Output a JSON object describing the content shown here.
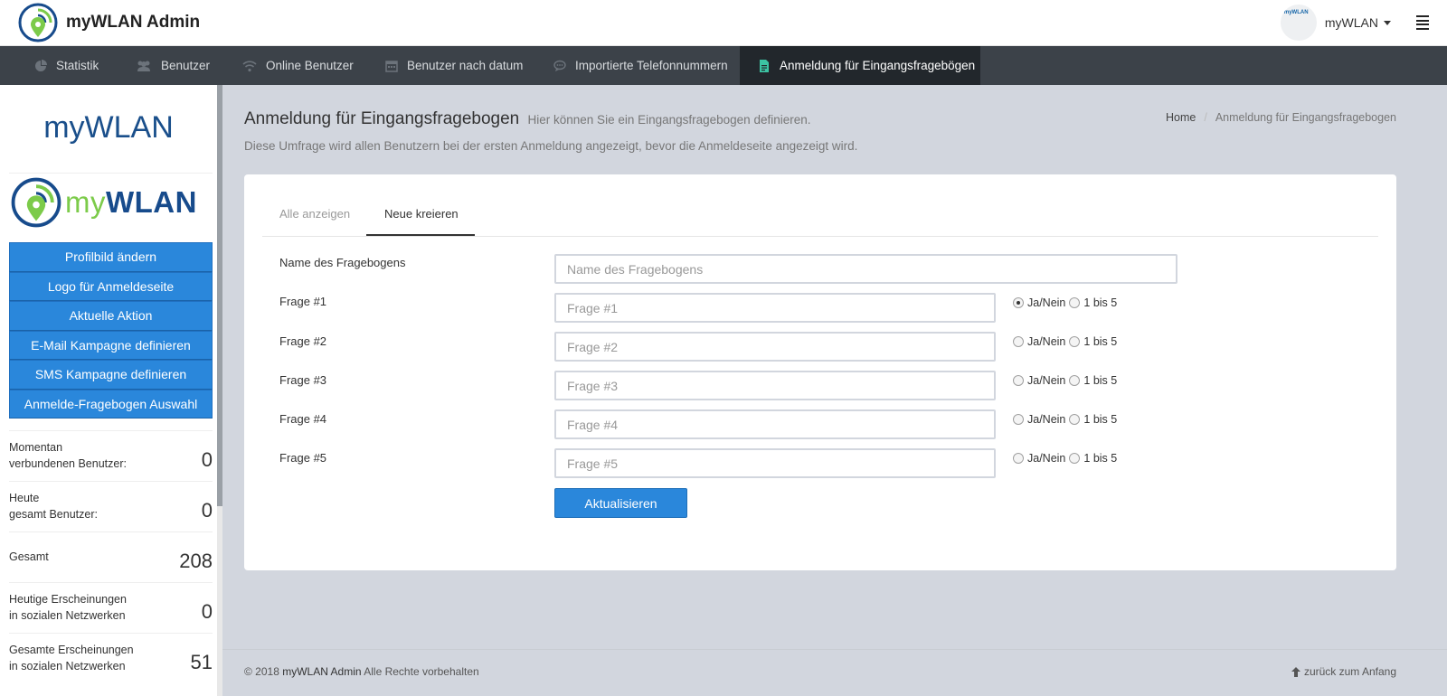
{
  "header": {
    "title": "myWLAN Admin",
    "avatar_text": "myWLAN",
    "user_name": "myWLAN"
  },
  "nav": {
    "items": [
      {
        "label": "Statistik",
        "icon": "pie-chart-icon"
      },
      {
        "label": "Benutzer",
        "icon": "users-icon"
      },
      {
        "label": "Online Benutzer",
        "icon": "wifi-icon"
      },
      {
        "label": "Benutzer nach datum",
        "icon": "calendar-icon"
      },
      {
        "label": "Importierte Telefonnummern",
        "icon": "chat-icon"
      },
      {
        "label": "Anmeldung für Eingangsfragebögen",
        "icon": "document-icon",
        "active": true
      }
    ]
  },
  "sidebar": {
    "title": "myWLAN",
    "logo_my": "my",
    "logo_wlan": "WLAN",
    "buttons": [
      "Profilbild ändern",
      "Logo für Anmeldeseite",
      "Aktuelle Aktion",
      "E-Mail Kampagne definieren",
      "SMS Kampagne definieren",
      "Anmelde-Fragebogen Auswahl"
    ],
    "stats": [
      {
        "label1": "Momentan",
        "label2": "verbundenen Benutzer:",
        "value": "0"
      },
      {
        "label1": "Heute",
        "label2": "gesamt Benutzer:",
        "value": "0"
      },
      {
        "label1": "Gesamt",
        "label2": "",
        "value": "208"
      },
      {
        "label1": "Heutige Erscheinungen",
        "label2": "in sozialen Netzwerken",
        "value": "0"
      },
      {
        "label1": "Gesamte Erscheinungen",
        "label2": "in sozialen Netzwerken",
        "value": "51"
      }
    ]
  },
  "page": {
    "title": "Anmeldung für Eingangsfragebogen",
    "subtitle": "Hier können Sie ein Eingangsfragebogen definieren.",
    "description": "Diese Umfrage wird allen Benutzern bei der ersten Anmeldung angezeigt, bevor die Anmeldeseite angezeigt wird.",
    "breadcrumb_home": "Home",
    "breadcrumb_current": "Anmeldung für Eingangsfragebogen"
  },
  "tabs": {
    "all": "Alle anzeigen",
    "new": "Neue kreieren"
  },
  "form": {
    "name_label": "Name des Fragebogens",
    "name_placeholder": "Name des Fragebogens",
    "radio_yesno": "Ja/Nein",
    "radio_scale": "1 bis 5",
    "questions": [
      {
        "label": "Frage #1",
        "placeholder": "Frage #1",
        "selected": "Ja/Nein"
      },
      {
        "label": "Frage #2",
        "placeholder": "Frage #2",
        "selected": ""
      },
      {
        "label": "Frage #3",
        "placeholder": "Frage #3",
        "selected": ""
      },
      {
        "label": "Frage #4",
        "placeholder": "Frage #4",
        "selected": ""
      },
      {
        "label": "Frage #5",
        "placeholder": "Frage #5",
        "selected": ""
      }
    ],
    "submit_label": "Aktualisieren"
  },
  "footer": {
    "copyright_prefix": "© 2018",
    "brand": "myWLAN Admin",
    "copyright_suffix": "Alle Rechte vorbehalten",
    "back_to_top": "zurück zum Anfang"
  },
  "colors": {
    "nav_bg": "#3c4249",
    "nav_active_bg": "#22272c",
    "primary": "#2a87db",
    "content_bg": "#d2d6de",
    "logo_blue": "#174b8c",
    "logo_green": "#7ccb4a"
  }
}
